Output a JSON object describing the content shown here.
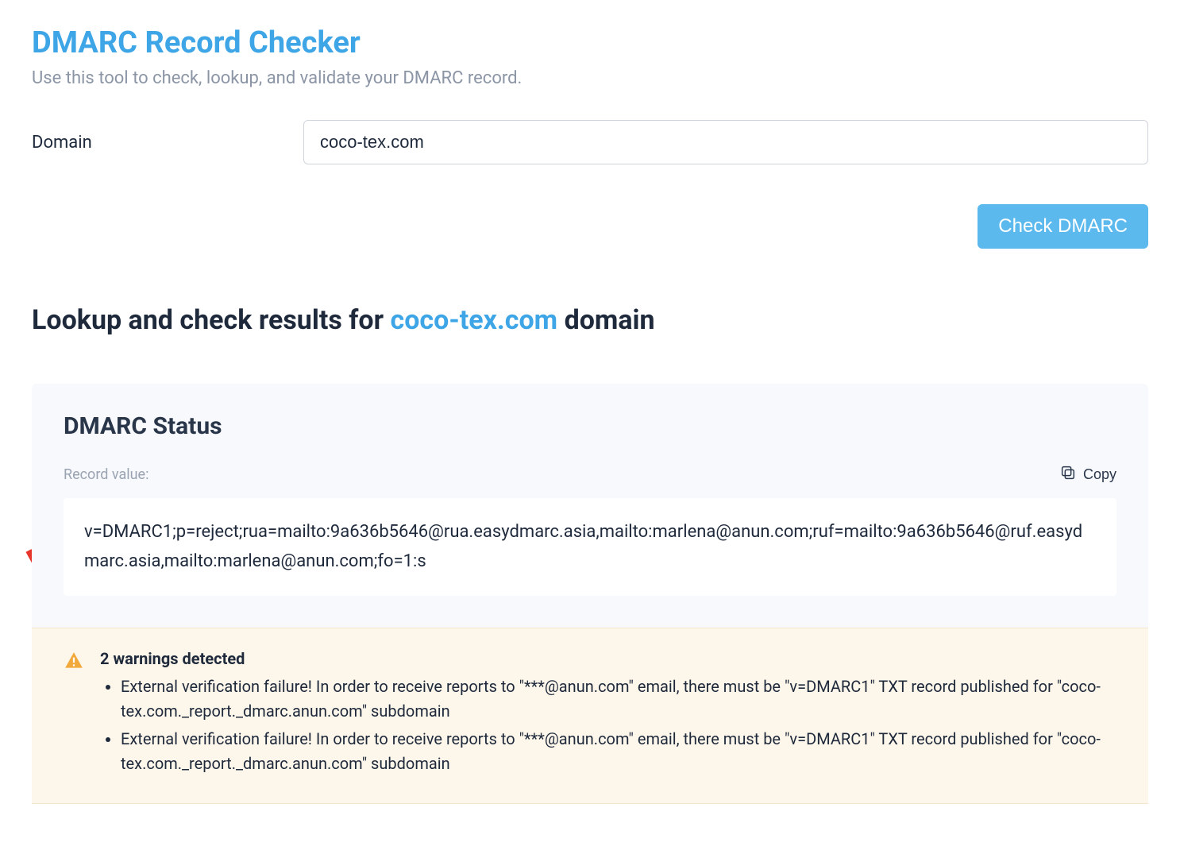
{
  "header": {
    "title": "DMARC Record Checker",
    "subtitle": "Use this tool to check, lookup, and validate your DMARC record."
  },
  "form": {
    "domain_label": "Domain",
    "domain_value": "coco-tex.com",
    "check_button_label": "Check DMARC"
  },
  "results": {
    "heading_prefix": "Lookup and check results for ",
    "domain": "coco-tex.com",
    "heading_suffix": " domain"
  },
  "status": {
    "title": "DMARC Status",
    "record_label": "Record value:",
    "copy_label": "Copy",
    "record_value": "v=DMARC1;p=reject;rua=mailto:9a636b5646@rua.easydmarc.asia,mailto:marlena@anun.com;ruf=mailto:9a636b5646@ruf.easydmarc.asia,mailto:marlena@anun.com;fo=1:s"
  },
  "warnings": {
    "title": "2 warnings detected",
    "items": [
      "External verification failure! In order to receive reports to \"***@anun.com\" email, there must be \"v=DMARC1\" TXT record published for \"coco-tex.com._report._dmarc.anun.com\" subdomain",
      "External verification failure! In order to receive reports to \"***@anun.com\" email, there must be \"v=DMARC1\" TXT record published for \"coco-tex.com._report._dmarc.anun.com\" subdomain"
    ]
  }
}
